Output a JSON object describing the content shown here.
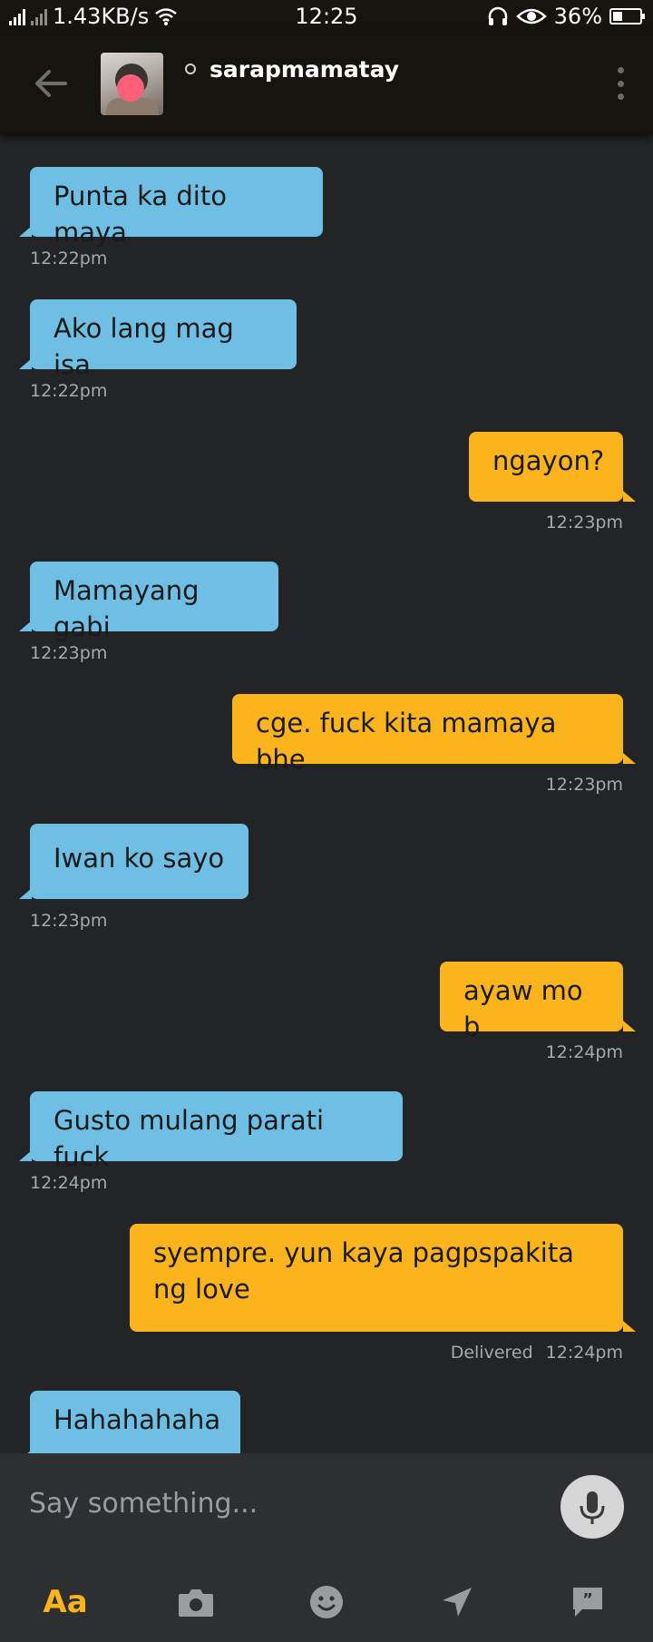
{
  "status_bar": {
    "network_speed": "1.43KB/s",
    "time": "12:25",
    "battery": "36%"
  },
  "header": {
    "contact_name": "sarapmamatay"
  },
  "messages": [
    {
      "direction": "in",
      "text": "Punta ka dito maya",
      "time": "12:22pm"
    },
    {
      "direction": "in",
      "text": "Ako lang mag isa",
      "time": "12:22pm"
    },
    {
      "direction": "out",
      "text": "ngayon?",
      "time": "12:23pm"
    },
    {
      "direction": "in",
      "text": "Mamayang gabi",
      "time": "12:23pm"
    },
    {
      "direction": "out",
      "text": "cge. fuck kita mamaya bhe",
      "time": "12:23pm"
    },
    {
      "direction": "in",
      "text": "Iwan ko sayo",
      "time": "12:23pm"
    },
    {
      "direction": "out",
      "text": "ayaw mo b",
      "time": "12:24pm"
    },
    {
      "direction": "in",
      "text": "Gusto mulang parati fuck",
      "time": "12:24pm"
    },
    {
      "direction": "out",
      "text": "syempre. yun kaya pagpspakita ng love",
      "time": "12:24pm",
      "status": "Delivered"
    },
    {
      "direction": "in",
      "text": "Hahahahaha",
      "time": ""
    }
  ],
  "composer": {
    "placeholder": "Say something..."
  },
  "toolbar": {
    "text_mode_label": "Aa",
    "icons": [
      "camera-icon",
      "emoji-icon",
      "location-icon",
      "saved-phrases-icon"
    ]
  },
  "colors": {
    "incoming_bubble": "#6fbfe4",
    "outgoing_bubble": "#fbb41b",
    "background": "#232427",
    "header": "#17140f"
  }
}
